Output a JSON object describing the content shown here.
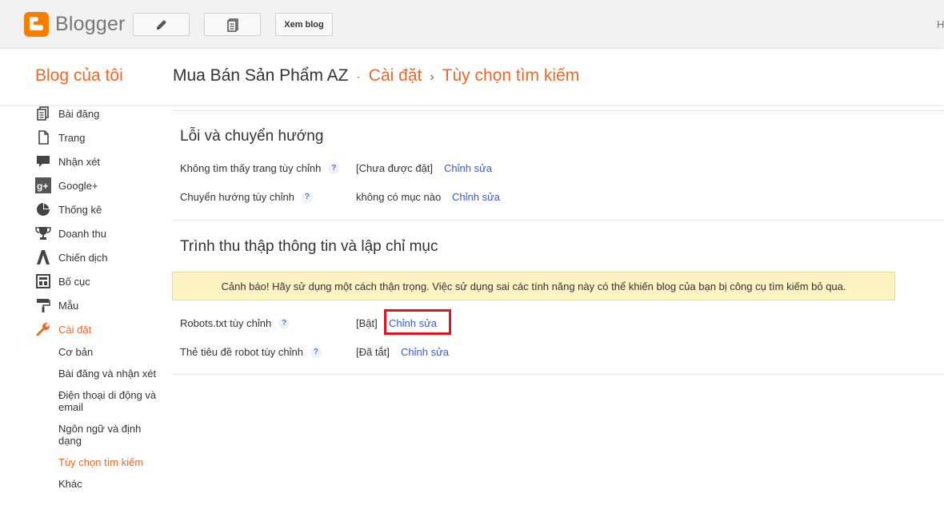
{
  "topbar": {
    "logo_text": "Blogger",
    "new_post_icon": "pencil-icon",
    "posts_icon": "document-list-icon",
    "view_blog_label": "Xem blog",
    "right_text": "H"
  },
  "header": {
    "my_blog": "Blog của tôi",
    "blog_name": "Mua Bán Sản Phẩm AZ",
    "sep1": "·",
    "crumb_settings": "Cài đặt",
    "sep2": "›",
    "crumb_current": "Tùy chọn tìm kiếm"
  },
  "sidebar": {
    "items": [
      {
        "label": "Bài đăng",
        "icon": "posts-icon"
      },
      {
        "label": "Trang",
        "icon": "pages-icon"
      },
      {
        "label": "Nhận xét",
        "icon": "comments-icon"
      },
      {
        "label": "Google+",
        "icon": "google-plus-icon"
      },
      {
        "label": "Thống kê",
        "icon": "stats-icon"
      },
      {
        "label": "Doanh thu",
        "icon": "trophy-icon"
      },
      {
        "label": "Chiến dịch",
        "icon": "adwords-icon"
      },
      {
        "label": "Bố cục",
        "icon": "layout-icon"
      },
      {
        "label": "Mẫu",
        "icon": "paint-roller-icon"
      },
      {
        "label": "Cài đặt",
        "icon": "wrench-icon"
      }
    ],
    "sub_items": [
      {
        "label": "Cơ bản"
      },
      {
        "label": "Bài đăng và nhận xét"
      },
      {
        "label": "Điện thoại di động và email"
      },
      {
        "label": "Ngôn ngữ và định dạng"
      },
      {
        "label": "Tùy chọn tìm kiếm"
      },
      {
        "label": "Khác"
      }
    ]
  },
  "errors_section": {
    "title": "Lỗi và chuyển hướng",
    "rows": [
      {
        "label": "Không tìm thấy trang tùy chỉnh",
        "help": "?",
        "value": "[Chưa được đặt]",
        "edit": "Chỉnh sửa"
      },
      {
        "label": "Chuyển hướng tùy chỉnh",
        "help": "?",
        "value": "không có mục nào",
        "edit": "Chỉnh sửa"
      }
    ]
  },
  "crawl_section": {
    "title": "Trình thu thập thông tin và lập chỉ mục",
    "warning": "Cảnh báo! Hãy sử dụng một cách thận trọng. Việc sử dụng sai các tính năng này có thể khiến blog của bạn bị công cụ tìm kiếm bỏ qua.",
    "rows": [
      {
        "label": "Robots.txt tùy chỉnh",
        "help": "?",
        "value": "[Bật]",
        "edit": "Chỉnh sửa"
      },
      {
        "label": "Thẻ tiêu đề robot tùy chỉnh",
        "help": "?",
        "value": "[Đã tắt]",
        "edit": "Chỉnh sửa"
      }
    ]
  },
  "colors": {
    "accent": "#e8692a",
    "link": "#3b5bb5",
    "warning_bg": "#fcf2c2",
    "highlight": "#e0151f"
  }
}
